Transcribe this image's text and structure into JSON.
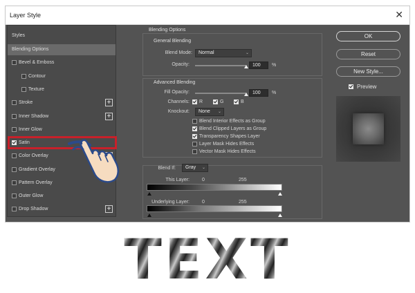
{
  "dialog": {
    "title": "Layer Style"
  },
  "left_panel": {
    "items": [
      {
        "label": "Styles",
        "checkbox": false,
        "checked": false,
        "plus": false
      },
      {
        "label": "Blending Options",
        "checkbox": false,
        "checked": false,
        "plus": false,
        "active": true
      },
      {
        "label": "Bevel & Emboss",
        "checkbox": true,
        "checked": false,
        "plus": false
      },
      {
        "label": "Contour",
        "checkbox": true,
        "checked": false,
        "plus": false,
        "sub": true
      },
      {
        "label": "Texture",
        "checkbox": true,
        "checked": false,
        "plus": false,
        "sub": true
      },
      {
        "label": "Stroke",
        "checkbox": true,
        "checked": false,
        "plus": true
      },
      {
        "label": "Inner Shadow",
        "checkbox": true,
        "checked": false,
        "plus": true
      },
      {
        "label": "Inner Glow",
        "checkbox": true,
        "checked": false,
        "plus": false
      },
      {
        "label": "Satin",
        "checkbox": true,
        "checked": true,
        "plus": false
      },
      {
        "label": "Color Overlay",
        "checkbox": true,
        "checked": false,
        "plus": true
      },
      {
        "label": "Gradient Overlay",
        "checkbox": true,
        "checked": false,
        "plus": true
      },
      {
        "label": "Pattern Overlay",
        "checkbox": true,
        "checked": false,
        "plus": false
      },
      {
        "label": "Outer Glow",
        "checkbox": true,
        "checked": false,
        "plus": false
      },
      {
        "label": "Drop Shadow",
        "checkbox": true,
        "checked": false,
        "plus": true
      }
    ]
  },
  "blending": {
    "section_title": "Blending Options",
    "general": {
      "title": "General Blending",
      "blend_mode_label": "Blend Mode:",
      "blend_mode_value": "Normal",
      "opacity_label": "Opacity:",
      "opacity_value": "100",
      "opacity_unit": "%",
      "opacity_level": 1.0
    },
    "advanced": {
      "title": "Advanced Blending",
      "fill_opacity_label": "Fill Opacity:",
      "fill_opacity_value": "100",
      "fill_opacity_unit": "%",
      "fill_opacity_level": 1.0,
      "channels_label": "Channels:",
      "channel_r": "R",
      "channel_g": "G",
      "channel_b": "B",
      "knockout_label": "Knockout:",
      "knockout_value": "None",
      "options": [
        {
          "label": "Blend Interior Effects as Group",
          "checked": false
        },
        {
          "label": "Blend Clipped Layers as Group",
          "checked": true
        },
        {
          "label": "Transparency Shapes Layer",
          "checked": true
        },
        {
          "label": "Layer Mask Hides Effects",
          "checked": false
        },
        {
          "label": "Vector Mask Hides Effects",
          "checked": false
        }
      ]
    },
    "blend_if": {
      "label": "Blend If:",
      "value": "Gray",
      "this_layer_label": "This Layer:",
      "this_layer_min": "0",
      "this_layer_max": "255",
      "underlying_label": "Underlying Layer:",
      "underlying_min": "0",
      "underlying_max": "255"
    }
  },
  "buttons": {
    "ok": "OK",
    "reset": "Reset",
    "new_style": "New Style...",
    "preview": "Preview"
  },
  "banner": {
    "text": "TEXT"
  }
}
